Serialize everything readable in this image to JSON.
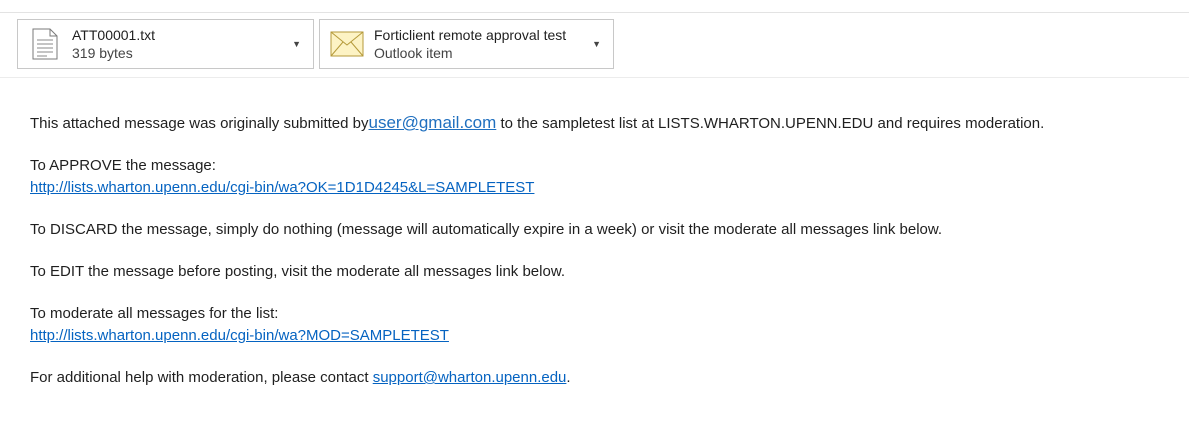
{
  "attachments": [
    {
      "name": "ATT00001.txt",
      "sub": "319 bytes",
      "icon": "text-file-icon"
    },
    {
      "name": "Forticlient remote approval test",
      "sub": "Outlook item",
      "icon": "envelope-icon"
    }
  ],
  "message": {
    "intro_before": "This attached  message was originally  submitted by",
    "intro_email": "user@gmail.com",
    "intro_after": " to the sampletest list at LISTS.WHARTON.UPENN.EDU and requires moderation.",
    "approve_label": "To APPROVE the message:",
    "approve_link": "http://lists.wharton.upenn.edu/cgi-bin/wa?OK=1D1D4245&L=SAMPLETEST",
    "discard_text": "To DISCARD the message, simply do nothing (message will automatically expire in a week) or visit the moderate all messages link below.",
    "edit_text": "To EDIT the message before posting, visit the moderate all messages link below.",
    "moderate_label": "To moderate all messages for the list:",
    "moderate_link": "http://lists.wharton.upenn.edu/cgi-bin/wa?MOD=SAMPLETEST",
    "help_before": "For additional help with moderation, please contact ",
    "help_email": "support@wharton.upenn.edu",
    "help_after": "."
  },
  "colors": {
    "link": "#0563c1",
    "text": "#1f1f1f",
    "border": "#c8c8c8"
  }
}
